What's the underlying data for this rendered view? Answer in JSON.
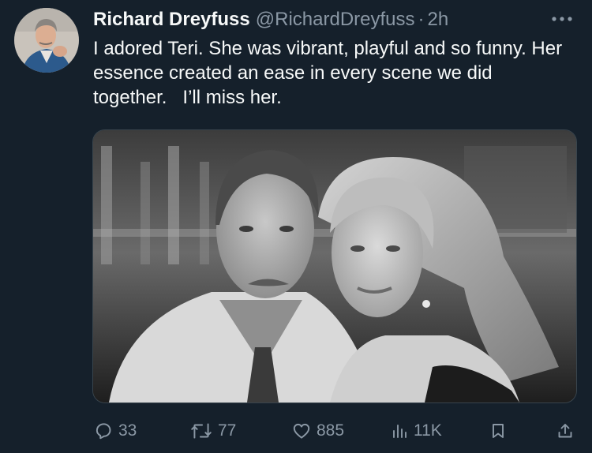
{
  "tweet": {
    "author": {
      "display_name": "Richard Dreyfuss",
      "handle": "@RichardDreyfuss",
      "separator": "·",
      "time": "2h",
      "avatar_icon": "profile-photo"
    },
    "more_icon": "more-horizontal-icon",
    "text": "I adored Teri. She was vibrant, playful and so funny. Her essence created an ease in every scene we did together.   I’ll miss her.",
    "media": {
      "description_icon": "black-and-white-photo-of-two-people"
    },
    "actions": {
      "replies": "33",
      "retweets": "77",
      "likes": "885",
      "views": "11K"
    },
    "colors": {
      "background": "#15202b",
      "text": "#f7f9f9",
      "secondary": "#8b98a5",
      "border": "#38444d"
    }
  }
}
